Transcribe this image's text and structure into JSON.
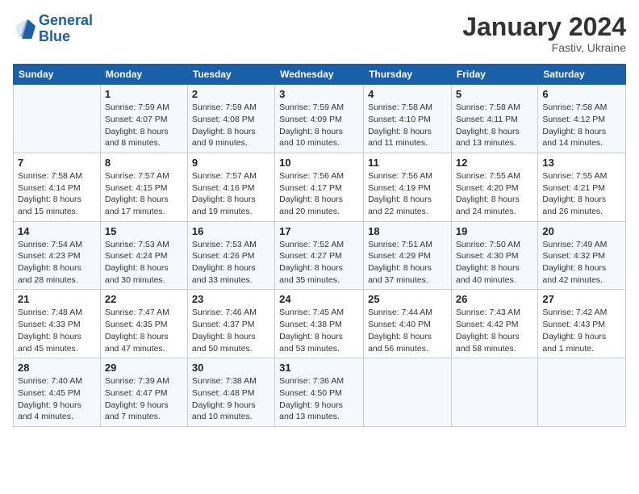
{
  "header": {
    "logo_line1": "General",
    "logo_line2": "Blue",
    "month": "January 2024",
    "location": "Fastiv, Ukraine"
  },
  "weekdays": [
    "Sunday",
    "Monday",
    "Tuesday",
    "Wednesday",
    "Thursday",
    "Friday",
    "Saturday"
  ],
  "weeks": [
    [
      {
        "day": "",
        "sunrise": "",
        "sunset": "",
        "daylight": ""
      },
      {
        "day": "1",
        "sunrise": "Sunrise: 7:59 AM",
        "sunset": "Sunset: 4:07 PM",
        "daylight": "Daylight: 8 hours and 8 minutes."
      },
      {
        "day": "2",
        "sunrise": "Sunrise: 7:59 AM",
        "sunset": "Sunset: 4:08 PM",
        "daylight": "Daylight: 8 hours and 9 minutes."
      },
      {
        "day": "3",
        "sunrise": "Sunrise: 7:59 AM",
        "sunset": "Sunset: 4:09 PM",
        "daylight": "Daylight: 8 hours and 10 minutes."
      },
      {
        "day": "4",
        "sunrise": "Sunrise: 7:58 AM",
        "sunset": "Sunset: 4:10 PM",
        "daylight": "Daylight: 8 hours and 11 minutes."
      },
      {
        "day": "5",
        "sunrise": "Sunrise: 7:58 AM",
        "sunset": "Sunset: 4:11 PM",
        "daylight": "Daylight: 8 hours and 13 minutes."
      },
      {
        "day": "6",
        "sunrise": "Sunrise: 7:58 AM",
        "sunset": "Sunset: 4:12 PM",
        "daylight": "Daylight: 8 hours and 14 minutes."
      }
    ],
    [
      {
        "day": "7",
        "sunrise": "Sunrise: 7:58 AM",
        "sunset": "Sunset: 4:14 PM",
        "daylight": "Daylight: 8 hours and 15 minutes."
      },
      {
        "day": "8",
        "sunrise": "Sunrise: 7:57 AM",
        "sunset": "Sunset: 4:15 PM",
        "daylight": "Daylight: 8 hours and 17 minutes."
      },
      {
        "day": "9",
        "sunrise": "Sunrise: 7:57 AM",
        "sunset": "Sunset: 4:16 PM",
        "daylight": "Daylight: 8 hours and 19 minutes."
      },
      {
        "day": "10",
        "sunrise": "Sunrise: 7:56 AM",
        "sunset": "Sunset: 4:17 PM",
        "daylight": "Daylight: 8 hours and 20 minutes."
      },
      {
        "day": "11",
        "sunrise": "Sunrise: 7:56 AM",
        "sunset": "Sunset: 4:19 PM",
        "daylight": "Daylight: 8 hours and 22 minutes."
      },
      {
        "day": "12",
        "sunrise": "Sunrise: 7:55 AM",
        "sunset": "Sunset: 4:20 PM",
        "daylight": "Daylight: 8 hours and 24 minutes."
      },
      {
        "day": "13",
        "sunrise": "Sunrise: 7:55 AM",
        "sunset": "Sunset: 4:21 PM",
        "daylight": "Daylight: 8 hours and 26 minutes."
      }
    ],
    [
      {
        "day": "14",
        "sunrise": "Sunrise: 7:54 AM",
        "sunset": "Sunset: 4:23 PM",
        "daylight": "Daylight: 8 hours and 28 minutes."
      },
      {
        "day": "15",
        "sunrise": "Sunrise: 7:53 AM",
        "sunset": "Sunset: 4:24 PM",
        "daylight": "Daylight: 8 hours and 30 minutes."
      },
      {
        "day": "16",
        "sunrise": "Sunrise: 7:53 AM",
        "sunset": "Sunset: 4:26 PM",
        "daylight": "Daylight: 8 hours and 33 minutes."
      },
      {
        "day": "17",
        "sunrise": "Sunrise: 7:52 AM",
        "sunset": "Sunset: 4:27 PM",
        "daylight": "Daylight: 8 hours and 35 minutes."
      },
      {
        "day": "18",
        "sunrise": "Sunrise: 7:51 AM",
        "sunset": "Sunset: 4:29 PM",
        "daylight": "Daylight: 8 hours and 37 minutes."
      },
      {
        "day": "19",
        "sunrise": "Sunrise: 7:50 AM",
        "sunset": "Sunset: 4:30 PM",
        "daylight": "Daylight: 8 hours and 40 minutes."
      },
      {
        "day": "20",
        "sunrise": "Sunrise: 7:49 AM",
        "sunset": "Sunset: 4:32 PM",
        "daylight": "Daylight: 8 hours and 42 minutes."
      }
    ],
    [
      {
        "day": "21",
        "sunrise": "Sunrise: 7:48 AM",
        "sunset": "Sunset: 4:33 PM",
        "daylight": "Daylight: 8 hours and 45 minutes."
      },
      {
        "day": "22",
        "sunrise": "Sunrise: 7:47 AM",
        "sunset": "Sunset: 4:35 PM",
        "daylight": "Daylight: 8 hours and 47 minutes."
      },
      {
        "day": "23",
        "sunrise": "Sunrise: 7:46 AM",
        "sunset": "Sunset: 4:37 PM",
        "daylight": "Daylight: 8 hours and 50 minutes."
      },
      {
        "day": "24",
        "sunrise": "Sunrise: 7:45 AM",
        "sunset": "Sunset: 4:38 PM",
        "daylight": "Daylight: 8 hours and 53 minutes."
      },
      {
        "day": "25",
        "sunrise": "Sunrise: 7:44 AM",
        "sunset": "Sunset: 4:40 PM",
        "daylight": "Daylight: 8 hours and 56 minutes."
      },
      {
        "day": "26",
        "sunrise": "Sunrise: 7:43 AM",
        "sunset": "Sunset: 4:42 PM",
        "daylight": "Daylight: 8 hours and 58 minutes."
      },
      {
        "day": "27",
        "sunrise": "Sunrise: 7:42 AM",
        "sunset": "Sunset: 4:43 PM",
        "daylight": "Daylight: 9 hours and 1 minute."
      }
    ],
    [
      {
        "day": "28",
        "sunrise": "Sunrise: 7:40 AM",
        "sunset": "Sunset: 4:45 PM",
        "daylight": "Daylight: 9 hours and 4 minutes."
      },
      {
        "day": "29",
        "sunrise": "Sunrise: 7:39 AM",
        "sunset": "Sunset: 4:47 PM",
        "daylight": "Daylight: 9 hours and 7 minutes."
      },
      {
        "day": "30",
        "sunrise": "Sunrise: 7:38 AM",
        "sunset": "Sunset: 4:48 PM",
        "daylight": "Daylight: 9 hours and 10 minutes."
      },
      {
        "day": "31",
        "sunrise": "Sunrise: 7:36 AM",
        "sunset": "Sunset: 4:50 PM",
        "daylight": "Daylight: 9 hours and 13 minutes."
      },
      {
        "day": "",
        "sunrise": "",
        "sunset": "",
        "daylight": ""
      },
      {
        "day": "",
        "sunrise": "",
        "sunset": "",
        "daylight": ""
      },
      {
        "day": "",
        "sunrise": "",
        "sunset": "",
        "daylight": ""
      }
    ]
  ]
}
